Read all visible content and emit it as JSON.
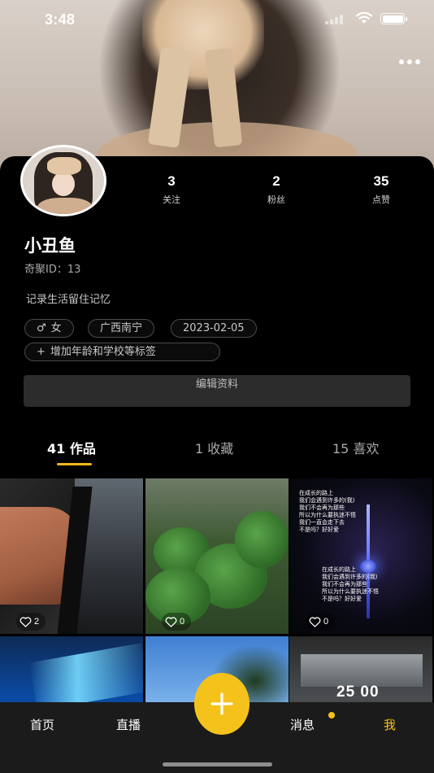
{
  "status_bar": {
    "time": "3:48"
  },
  "profile": {
    "name": "小丑鱼",
    "id_text": "奇聚ID：13",
    "bio": "记录生活留住记忆",
    "stats": [
      {
        "value": "3",
        "label": "关注"
      },
      {
        "value": "2",
        "label": "粉丝"
      },
      {
        "value": "35",
        "label": "点赞"
      }
    ],
    "tags": {
      "gender": "女",
      "gender_icon": "♂",
      "location": "广西南宁",
      "date": "2023-02-05",
      "add": "增加年龄和学校等标签",
      "add_icon": "+"
    },
    "edit_label": "编辑资料"
  },
  "tabs": [
    {
      "label": "41 作品",
      "active": true
    },
    {
      "label": "1 收藏",
      "active": false
    },
    {
      "label": "15 喜欢",
      "active": false
    }
  ],
  "posts": [
    {
      "likes": "2",
      "icon": "heart-outline-icon"
    },
    {
      "likes": "0",
      "icon": "heart-outline-icon"
    },
    {
      "likes": "0",
      "icon": "heart-outline-icon"
    }
  ],
  "thumb_texts": {
    "tower_top": "在成长的路上\n我们会遇到许多的(我)\n我们不会再为那些\n所以为什么要执迷不悟\n我们一直会走下去\n不是吗？好好爱",
    "tower_bottom": "在成长的路上\n我们会遇到许多的(我)\n我们不会再为那些\n所以为什么要执迷不悟\n不是吗？好好爱",
    "clock": "25 00"
  },
  "nav": {
    "home": "首页",
    "live": "直播",
    "messages": "消息",
    "me": "我"
  },
  "colors": {
    "accent": "#f5c21b",
    "background": "#000000",
    "nav_bg": "#1b1b1b"
  }
}
